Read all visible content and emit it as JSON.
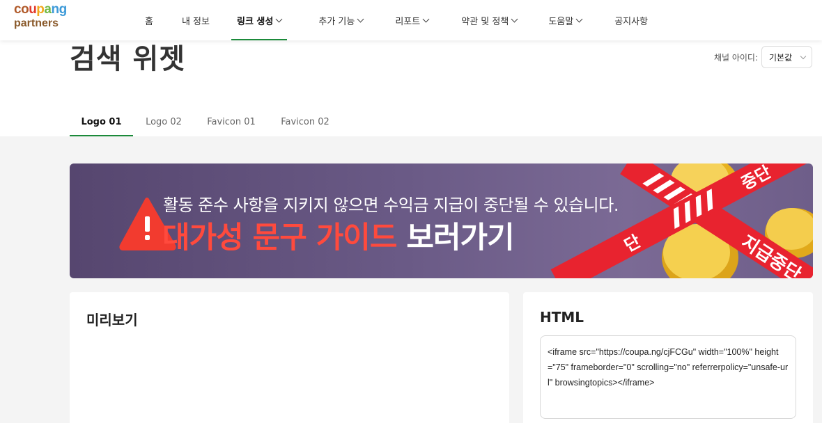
{
  "logo": {
    "line1_parts": [
      "co",
      "u",
      "p",
      "a",
      "ng"
    ],
    "line2": "partners"
  },
  "nav": {
    "items": [
      {
        "label": "홈",
        "dropdown": false
      },
      {
        "label": "내 정보",
        "dropdown": false
      },
      {
        "label": "링크 생성",
        "dropdown": true,
        "active": true
      },
      {
        "label": "추가 기능",
        "dropdown": true
      },
      {
        "label": "리포트",
        "dropdown": true
      },
      {
        "label": "약관 및 정책",
        "dropdown": true
      },
      {
        "label": "도움말",
        "dropdown": true
      },
      {
        "label": "공지사항",
        "dropdown": false
      }
    ]
  },
  "page": {
    "title": "검색 위젯"
  },
  "channel": {
    "label": "채널 아이디:",
    "selected": "기본값"
  },
  "tabs": [
    {
      "label": "Logo 01",
      "active": true
    },
    {
      "label": "Logo 02"
    },
    {
      "label": "Favicon 01"
    },
    {
      "label": "Favicon 02"
    }
  ],
  "banner": {
    "line1": "활동 준수 사항을 지키지 않으면 수익금 지급이 중단될 수 있습니다.",
    "line2_red": "대가성 문구 가이드",
    "line2_white": "보러가기",
    "tape_texts": [
      "지급중단",
      "지급중단",
      "단",
      "중단"
    ],
    "colors": {
      "background": "#5f4f7a",
      "warning": "#f23b2f",
      "tape": "#e8232f",
      "coin": "#f1c232"
    }
  },
  "preview": {
    "title": "미리보기"
  },
  "html_panel": {
    "title": "HTML",
    "code": "<iframe src=\"https://coupa.ng/cjFCGu\" width=\"100%\" height=\"75\" frameborder=\"0\" scrolling=\"no\" referrerpolicy=\"unsafe-url\" browsingtopics></iframe>"
  }
}
